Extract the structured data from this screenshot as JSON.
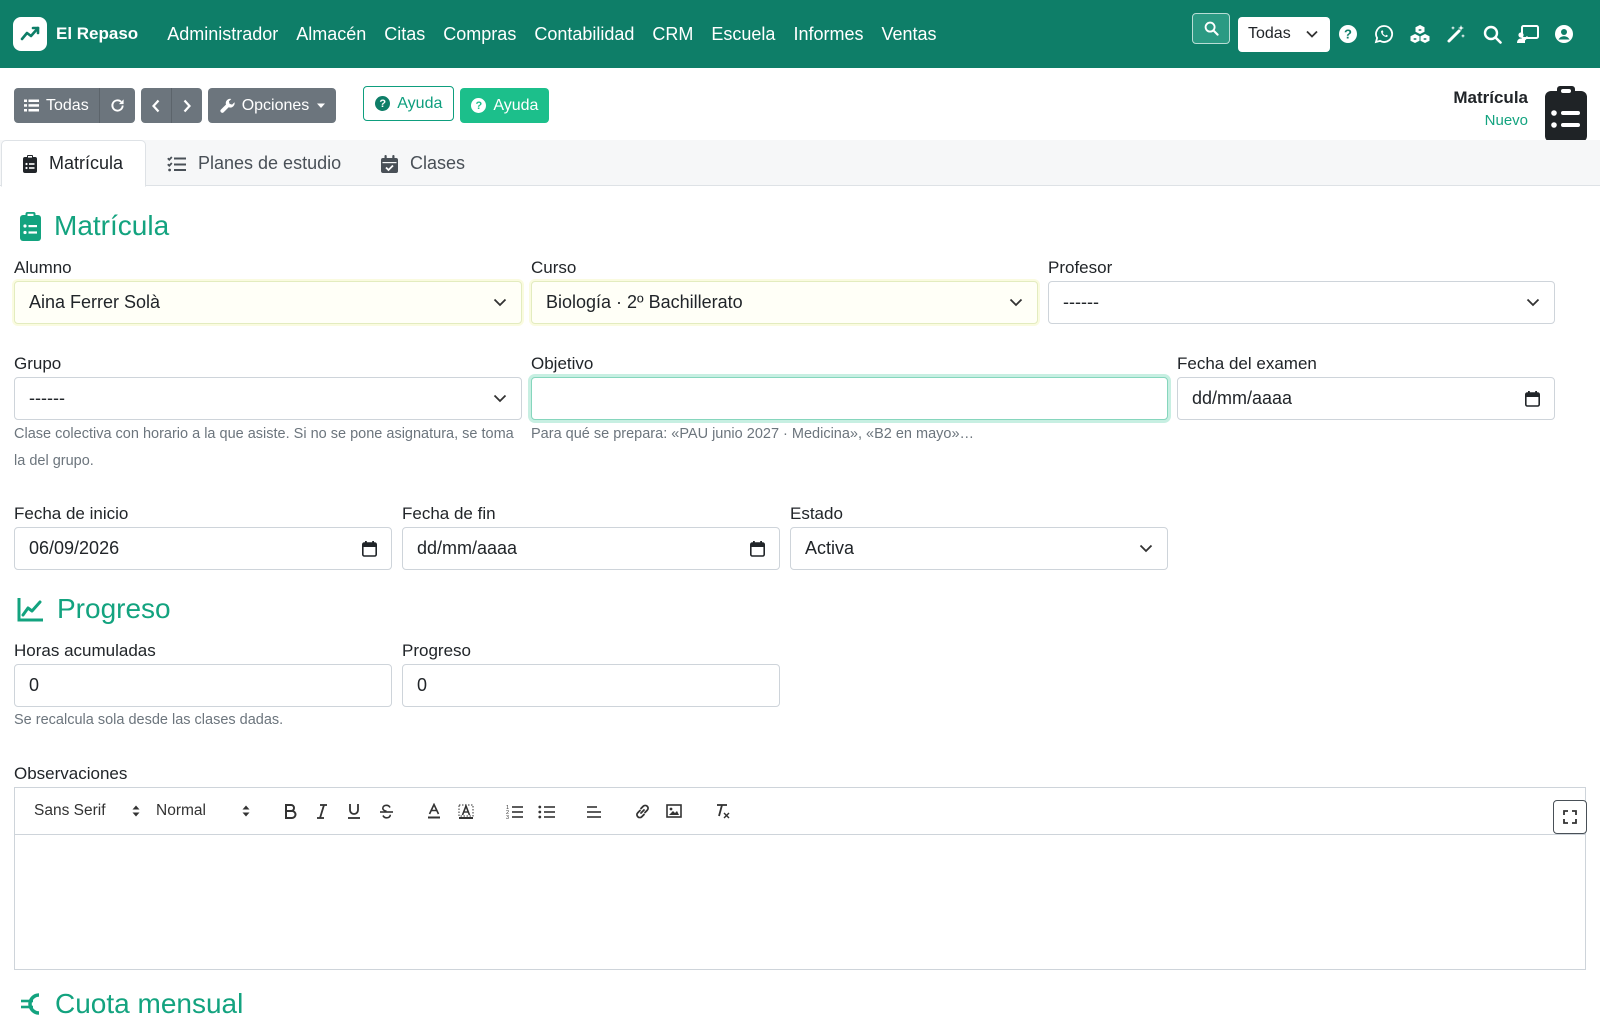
{
  "navbar": {
    "brand": "El Repaso",
    "menu": [
      "Administrador",
      "Almacén",
      "Citas",
      "Compras",
      "Contabilidad",
      "CRM",
      "Escuela",
      "Informes",
      "Ventas"
    ],
    "company_select": "Todas",
    "icons": [
      "search-icon",
      "help-icon",
      "whatsapp-icon",
      "cubes-icon",
      "magic-wand-icon",
      "search-icon",
      "chalkboard-user-icon",
      "user-circle-icon"
    ],
    "bg_color": "#0e7e68"
  },
  "toolbar": {
    "list_label": "Todas",
    "options_label": "Opciones",
    "help_outline_label": "Ayuda",
    "help_label": "Ayuda"
  },
  "document": {
    "title": "Matrícula",
    "status": "Nuevo"
  },
  "tabs": [
    {
      "label": "Matrícula",
      "active": true
    },
    {
      "label": "Planes de estudio",
      "active": false
    },
    {
      "label": "Clases",
      "active": false
    }
  ],
  "form": {
    "section_matricula": "Matrícula",
    "alumno": {
      "label": "Alumno",
      "value": "Aina Ferrer Solà"
    },
    "curso": {
      "label": "Curso",
      "value": "Biología · 2º Bachillerato"
    },
    "profesor": {
      "label": "Profesor",
      "value": "------"
    },
    "grupo": {
      "label": "Grupo",
      "value": "------",
      "help": "Clase colectiva con horario a la que asiste. Si no se pone asignatura, se toma la del grupo."
    },
    "objetivo": {
      "label": "Objetivo",
      "value": "",
      "help": "Para qué se prepara: «PAU junio 2027 · Medicina», «B2 en mayo»…"
    },
    "fecha_examen": {
      "label": "Fecha del examen",
      "value": "dd/mm/aaaa"
    },
    "fecha_inicio": {
      "label": "Fecha de inicio",
      "value": "06/09/2026"
    },
    "fecha_fin": {
      "label": "Fecha de fin",
      "value": "dd/mm/aaaa"
    },
    "estado": {
      "label": "Estado",
      "value": "Activa"
    },
    "section_progreso": "Progreso",
    "horas": {
      "label": "Horas acumuladas",
      "value": "0",
      "help": "Se recalcula sola desde las clases dadas."
    },
    "progreso": {
      "label": "Progreso",
      "value": "0"
    },
    "observaciones": {
      "label": "Observaciones",
      "font": "Sans Serif",
      "size": "Normal"
    },
    "section_cuota": "Cuota mensual"
  },
  "colors": {
    "accent": "#13a37f",
    "help_button": "#1cbf8b",
    "gray_button": "#6c757d"
  }
}
